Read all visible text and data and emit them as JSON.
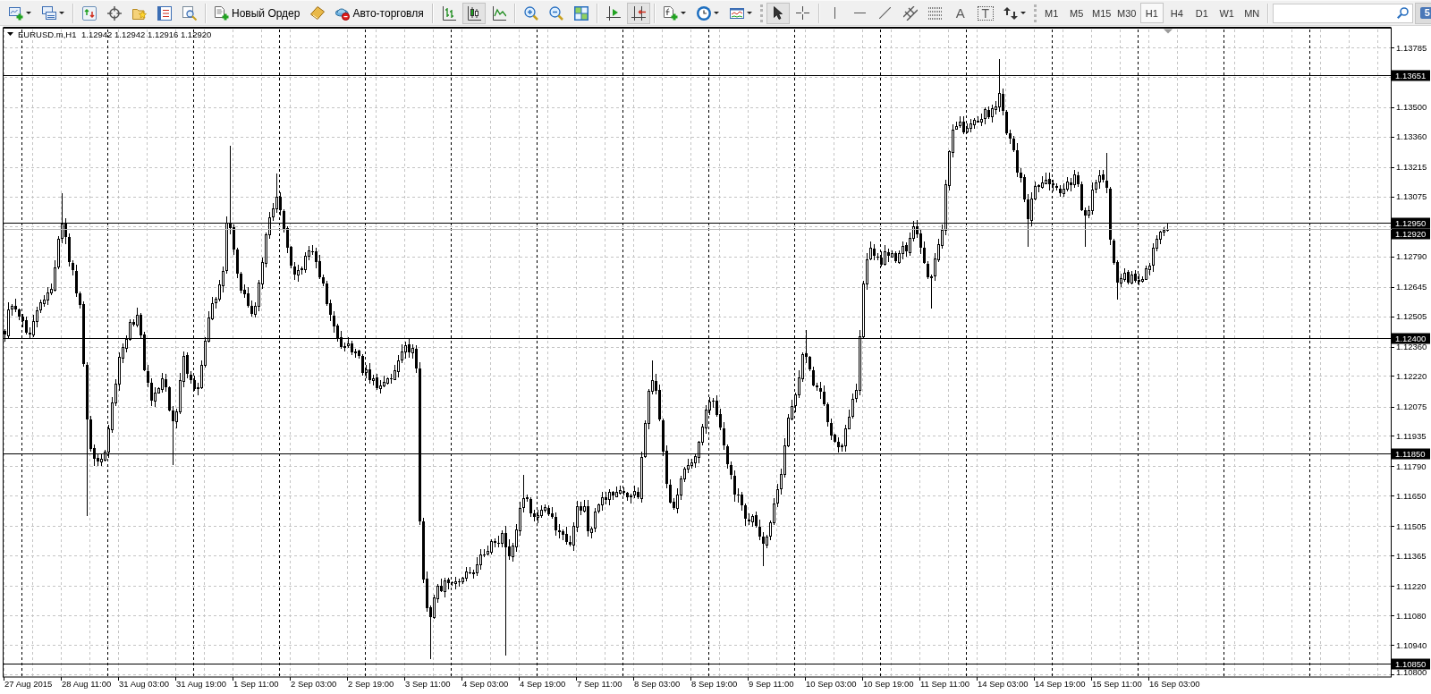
{
  "toolbar": {
    "groups": [
      {
        "handle": false,
        "buttons": [
          {
            "kind": "icon",
            "dropdown": true,
            "pressed": false
          },
          {
            "kind": "icon",
            "dropdown": true,
            "pressed": false
          }
        ]
      },
      {
        "handle": false,
        "buttons": [
          {
            "kind": "icon",
            "dropdown": false,
            "pressed": false
          },
          {
            "kind": "icon",
            "dropdown": false,
            "pressed": false
          },
          {
            "kind": "icon",
            "dropdown": false,
            "pressed": false
          },
          {
            "kind": "icon",
            "dropdown": false,
            "pressed": false
          },
          {
            "kind": "icon",
            "dropdown": false,
            "pressed": false
          }
        ]
      },
      {
        "handle": false,
        "buttons": [
          {
            "kind": "text",
            "label": "Новый Ордер",
            "dropdown": false,
            "pressed": false
          },
          {
            "kind": "icon",
            "dropdown": false,
            "pressed": false
          },
          {
            "kind": "text",
            "label": "Авто-торговля",
            "dropdown": false,
            "pressed": false
          }
        ]
      },
      {
        "handle": false,
        "buttons": [
          {
            "kind": "icon",
            "dropdown": false,
            "pressed": false
          },
          {
            "kind": "icon",
            "dropdown": false,
            "pressed": true
          },
          {
            "kind": "icon",
            "dropdown": false,
            "pressed": false
          }
        ]
      },
      {
        "handle": false,
        "buttons": [
          {
            "kind": "icon",
            "dropdown": false,
            "pressed": false
          },
          {
            "kind": "icon",
            "dropdown": false,
            "pressed": false
          },
          {
            "kind": "icon",
            "dropdown": false,
            "pressed": false
          }
        ]
      },
      {
        "handle": false,
        "buttons": [
          {
            "kind": "icon",
            "dropdown": false,
            "pressed": false
          },
          {
            "kind": "icon",
            "dropdown": false,
            "pressed": true
          }
        ]
      },
      {
        "handle": false,
        "buttons": [
          {
            "kind": "icon",
            "dropdown": true,
            "pressed": false
          },
          {
            "kind": "icon",
            "dropdown": true,
            "pressed": false
          },
          {
            "kind": "icon",
            "dropdown": true,
            "pressed": false
          }
        ]
      },
      {
        "handle": true,
        "buttons": [
          {
            "kind": "icon",
            "dropdown": false,
            "pressed": true
          },
          {
            "kind": "icon",
            "dropdown": false,
            "pressed": false
          }
        ]
      },
      {
        "handle": false,
        "buttons": [
          {
            "kind": "icon",
            "dropdown": false,
            "pressed": false
          },
          {
            "kind": "icon",
            "dropdown": false,
            "pressed": false
          },
          {
            "kind": "icon",
            "dropdown": false,
            "pressed": false
          },
          {
            "kind": "icon",
            "dropdown": false,
            "pressed": false
          },
          {
            "kind": "icon",
            "dropdown": false,
            "pressed": false
          },
          {
            "kind": "glyph",
            "label": "A",
            "dropdown": false,
            "pressed": false
          },
          {
            "kind": "boxed-glyph",
            "label": "T",
            "dropdown": false,
            "pressed": false
          },
          {
            "kind": "icon",
            "dropdown": true,
            "pressed": false
          }
        ]
      }
    ]
  },
  "timeframes": {
    "handle": true,
    "items": [
      {
        "label": "M1",
        "selected": false
      },
      {
        "label": "M5",
        "selected": false
      },
      {
        "label": "M15",
        "selected": false
      },
      {
        "label": "M30",
        "selected": false
      },
      {
        "label": "H1",
        "selected": true
      },
      {
        "label": "H4",
        "selected": false
      },
      {
        "label": "D1",
        "selected": false
      },
      {
        "label": "W1",
        "selected": false
      },
      {
        "label": "MN",
        "selected": false
      }
    ]
  },
  "messages": {
    "count": "5"
  },
  "chart": {
    "symbol": "EURUSD.m,H1",
    "quote": "1.12942 1.12942 1.12916 1.12920",
    "price_axis": [
      "1.13785",
      "1.13500",
      "1.13360",
      "1.13215",
      "1.13075",
      "1.12790",
      "1.12645",
      "1.12505",
      "1.12360",
      "1.12220",
      "1.12075",
      "1.11935",
      "1.11790",
      "1.11650",
      "1.11505",
      "1.11365",
      "1.11220",
      "1.11080",
      "1.10940",
      "1.10800"
    ],
    "levels": [
      {
        "kind": "level",
        "label": "1.13651"
      },
      {
        "kind": "level",
        "label": "1.12950"
      },
      {
        "kind": "bid",
        "label": "1.12920"
      },
      {
        "kind": "level",
        "label": "1.12400"
      },
      {
        "kind": "level",
        "label": "1.11850"
      },
      {
        "kind": "level",
        "label": "1.10850"
      }
    ],
    "time_axis": [
      "27 Aug 2015",
      "28 Aug 11:00",
      "31 Aug 03:00",
      "31 Aug 19:00",
      "1 Sep 11:00",
      "2 Sep 03:00",
      "2 Sep 19:00",
      "3 Sep 11:00",
      "4 Sep 03:00",
      "4 Sep 19:00",
      "7 Sep 11:00",
      "8 Sep 03:00",
      "8 Sep 19:00",
      "9 Sep 11:00",
      "10 Sep 03:00",
      "10 Sep 19:00",
      "11 Sep 11:00",
      "14 Sep 03:00",
      "14 Sep 19:00",
      "15 Sep 11:00",
      "16 Sep 03:00"
    ]
  }
}
